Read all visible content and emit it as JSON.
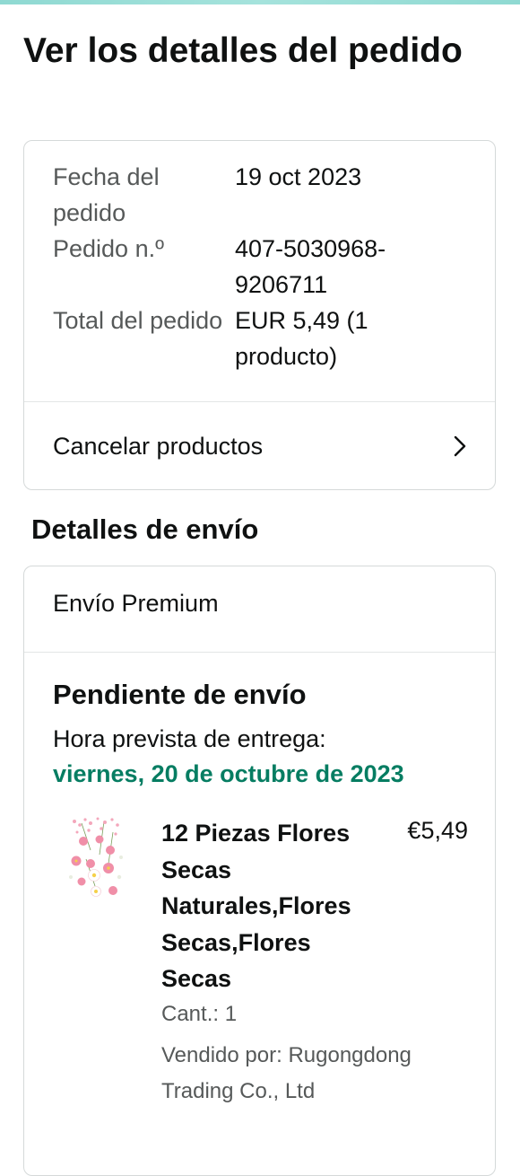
{
  "header": {
    "title": "Ver los detalles del pedido"
  },
  "summary": {
    "rows": [
      {
        "label": "Fecha del pedido",
        "value": "19 oct 2023"
      },
      {
        "label": "Pedido n.º",
        "value": "407-5030968-9206711"
      },
      {
        "label": "Total del pedido",
        "value": "EUR 5,49 (1 producto)"
      }
    ],
    "cancel_label": "Cancelar productos",
    "cancel_icon": "chevron-right-icon"
  },
  "shipping": {
    "section_title": "Detalles de envío",
    "ship_type": "Envío Premium",
    "status": "Pendiente de envío",
    "eta_label": "Hora prevista de entrega:",
    "eta_date": "viernes, 20 de octubre de 2023",
    "eta_color": "#067d62",
    "item": {
      "title": "12 Piezas Flores Secas Naturales,Flores Secas,Flores Secas",
      "price": "€5,49",
      "quantity": "Cant.: 1",
      "seller": "Vendido por: Rugongdong Trading Co., Ltd",
      "image_icon": "dried-flowers-product-image"
    }
  }
}
